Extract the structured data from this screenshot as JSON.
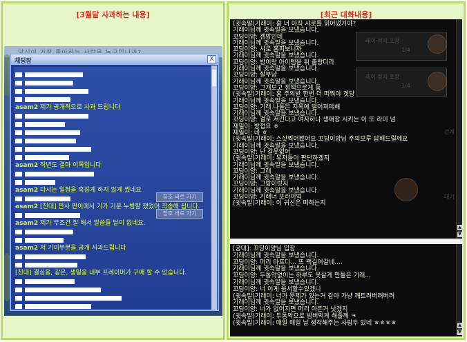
{
  "left_panel": {
    "caption": "[3월달 사과하는 내용]",
    "scene_top_text": "당신이 가장 좋아하는 사람은 누구입니까?",
    "chat_title": "채팅창",
    "close_label": "X",
    "messages": [
      {
        "name": "asam2",
        "text": "제가 공개적으로 사과 드립니다"
      },
      {
        "name": "asam2",
        "text": "작년도 결마 이쪽입니다"
      },
      {
        "name": "asam2",
        "text": "다시는 일청을 흑장게 하지 않게 썼네요"
      },
      {
        "name": "asam2",
        "text": "[친대] 판사 판이에서 기가 기분 누범할 했었어 죄송해 됩니다."
      },
      {
        "name": "asam2",
        "text": "제가 무조건 잘 해서 말씀들 달이 없네요."
      },
      {
        "name": "asam2",
        "text": "저 기이부분을 공개 사과드립니다"
      },
      {
        "name": "",
        "text": "[친대] 결심을, 같은, 생일을 내부 프레이머가 구매 할 수 있습니다."
      }
    ],
    "ghost_buttons": [
      "칭호 바로 가기",
      "칭호 바로 가기"
    ]
  },
  "right_panel": {
    "caption": "[최근 대화내용]",
    "log_top": [
      "(귓속말)기래이: 홈 너 아직 샤로를 읽어냈거야?",
      "기래이님께 귓속말을 보냈습니다.",
      "꼬딩이양: 겜방인데",
      "기래이님께 귓속말을 보냈습니다.",
      "꼬딩이양: 샤로 홈피보니까",
      "기래이님께 귓속말을 보냈습니다.",
      "꼬딩이양: 밥이랑 아이템을 튀 출랑더라",
      "기래이님께 귓속말을 보냈습니다.",
      "꼬딩이양: 잘부냥",
      "기래이님께 귓속말을 보냈습니다.",
      "꼬딩이양: 그개보고 정책으로게 등",
      "(귓속말)기래이: 홈 주의받 한번 더 떠뭐야 겟당",
      "기래이님께 귓속말을 보냈습니다.",
      "꼬딩이양: 기래 나들은 지옥에 떨어져야해",
      "기래이님께 귓속말을 보냈습니다.",
      "꼬딩이양: 걸로 저긴다고 여자하나 생매장 시키는 이 또 라이 넘",
      "재일이: 방접요 ㅎ",
      "재일이: 네 ㅎ",
      "(귓속말)기래이: 스샷찍어봤어요 꼬딩이양님 주의보루 답해드릴께요",
      "기래이님께 귓속말을 보냈습니다.",
      "꼬딩이양: 난 갈못없어",
      "(귓속말)기래이: 유저들이 판단하겠지",
      "기래이님께 귓속말을 보냈습니다.",
      "꼬딩이양: 그래",
      "기래이님께 귓속말을 보냈습니다.",
      "꼬딩이양: 그랑이랏지",
      "기래이님께 귓속말을 보냈습니다.",
      "꼬딩이양: 기래너 또라이억",
      "(귓속말)기래이: 이 귀신은 며하는지"
    ],
    "log_bottom": [
      "[공대]: 꼬딩이양님 입장",
      "기래이님께 귓속말을 보냈습니다.",
      "꼬딩이양: 머리 아프다... 또 꽥길어갈네....",
      "기래이님께 귓속말을 보냈습니다.",
      "꼬딩이양: 두통악없이는 하루도 못살게 만들은 기래...",
      "기래이님께 귓속말을 보냈습니다.",
      "꼬딩이양: 너 어게 움서할수있겠니",
      "(귓속말)기래이: 너가 문제가 있는거 같아 가냥 깨트려버려버려",
      "기래이님께 귓속말을 보냈습니다.",
      "꼬딩이양: 너가 없어지면 머리 아픈거 낫겠지",
      "(귓속말)기래이: 두통악으로 밥버먹게 해줄께 ㅋ",
      "(귓속말)기래이: 매일 매일 날 생각해주는 사람두 있네 ㅎㅎㅎㅎ"
    ],
    "background_labels": [
      "레이 정지 포함",
      "1/4",
      "레이 정지 포함",
      "1/4",
      "관계",
      "대기"
    ]
  }
}
